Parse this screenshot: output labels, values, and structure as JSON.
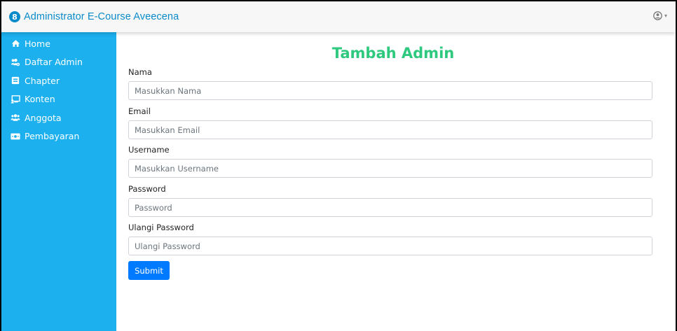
{
  "navbar": {
    "brand_logo_text": "8",
    "brand_title": "Administrator E-Course Aveecena",
    "user_icon": "user-circle-icon",
    "caret": "▾"
  },
  "sidebar": {
    "items": [
      {
        "label": "Home",
        "icon": "home-icon"
      },
      {
        "label": "Daftar Admin",
        "icon": "users-cog-icon"
      },
      {
        "label": "Chapter",
        "icon": "book-icon"
      },
      {
        "label": "Konten",
        "icon": "chalkboard-icon"
      },
      {
        "label": "Anggota",
        "icon": "users-icon"
      },
      {
        "label": "Pembayaran",
        "icon": "money-bill-icon"
      }
    ]
  },
  "main": {
    "title": "Tambah Admin",
    "fields": [
      {
        "label": "Nama",
        "placeholder": "Masukkan Nama"
      },
      {
        "label": "Email",
        "placeholder": "Masukkan Email"
      },
      {
        "label": "Username",
        "placeholder": "Masukkan Username"
      },
      {
        "label": "Password",
        "placeholder": "Password"
      },
      {
        "label": "Ulangi Password",
        "placeholder": "Ulangi Password"
      }
    ],
    "submit_label": "Submit"
  },
  "colors": {
    "brand": "#0a8bc9",
    "sidebar": "#1cb0ef",
    "title": "#2ec97f",
    "button": "#007bff"
  }
}
